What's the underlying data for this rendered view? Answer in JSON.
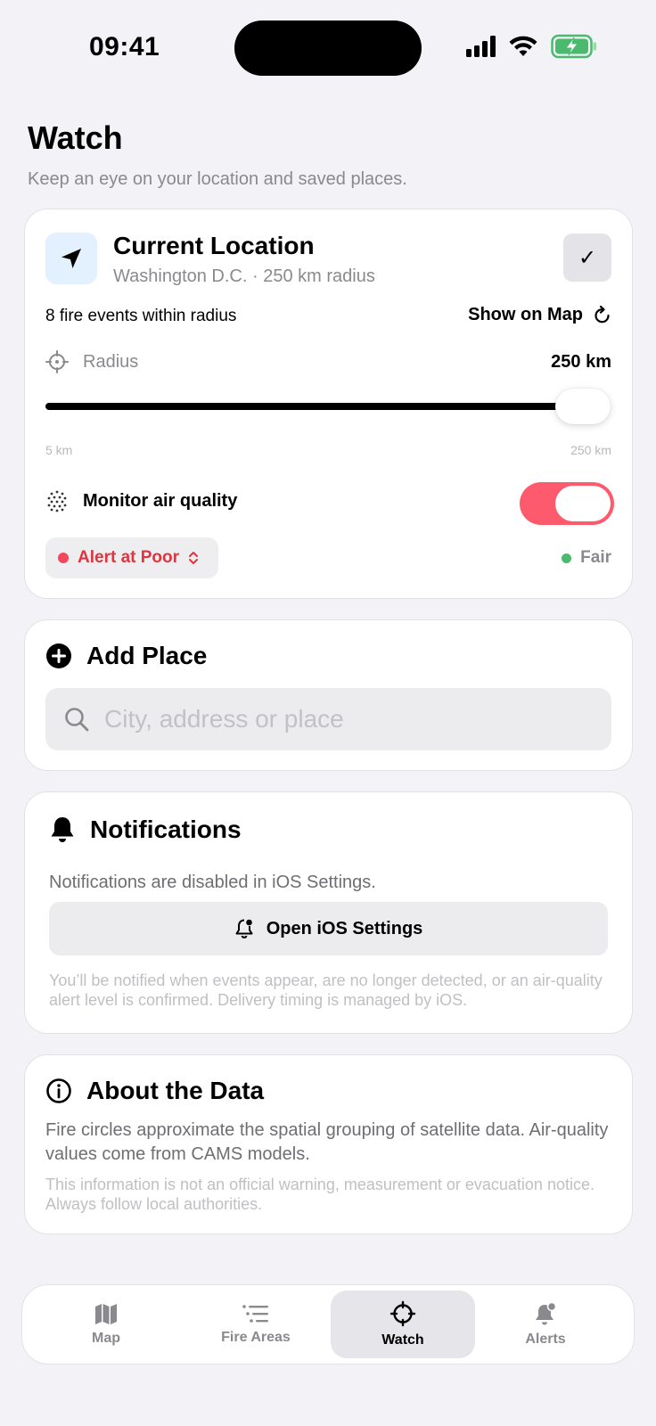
{
  "status_bar": {
    "time": "09:41"
  },
  "header": {
    "title": "Watch",
    "subtitle": "Keep an eye on your location and saved places."
  },
  "location_card": {
    "title": "Current Location",
    "subtitle": "Washington D.C. · 250 km radius",
    "check": "✓",
    "fire_events": "8 fire events within radius",
    "show_on_map": "Show on Map",
    "radius_label": "Radius",
    "radius_value": "250 km",
    "slider": {
      "min_label": "5 km",
      "max_label": "250 km",
      "min": 5,
      "max": 250,
      "value": 250
    },
    "air_quality_label": "Monitor air quality",
    "air_quality_enabled": true,
    "alert_level": "Alert at Poor",
    "current_level": "Fair",
    "colors": {
      "toggle_on": "#fd5a6e",
      "alert_red": "#e2333f",
      "fair_green": "#4cba6e",
      "location_bg": "#e3f0fd"
    }
  },
  "add_place": {
    "title": "Add Place",
    "search_placeholder": "City, address or place",
    "search_value": ""
  },
  "notifications": {
    "title": "Notifications",
    "status": "Notifications are disabled in iOS Settings.",
    "button": "Open iOS Settings",
    "footnote": "You’ll be notified when events appear, are no longer detected, or an air-quality alert level is confirmed. Delivery timing is managed by iOS."
  },
  "about": {
    "title": "About the Data",
    "body": "Fire circles approximate the spatial grouping of satellite data. Air-quality values come from CAMS models.",
    "footnote": "This information is not an official warning, measurement or evacuation notice. Always follow local authorities."
  },
  "tabbar": {
    "selected": "Watch",
    "tabs": [
      {
        "label": "Map",
        "icon": "map-icon"
      },
      {
        "label": "Fire Areas",
        "icon": "list-icon"
      },
      {
        "label": "Watch",
        "icon": "crosshair-icon"
      },
      {
        "label": "Alerts",
        "icon": "bell-badge-icon"
      }
    ]
  }
}
